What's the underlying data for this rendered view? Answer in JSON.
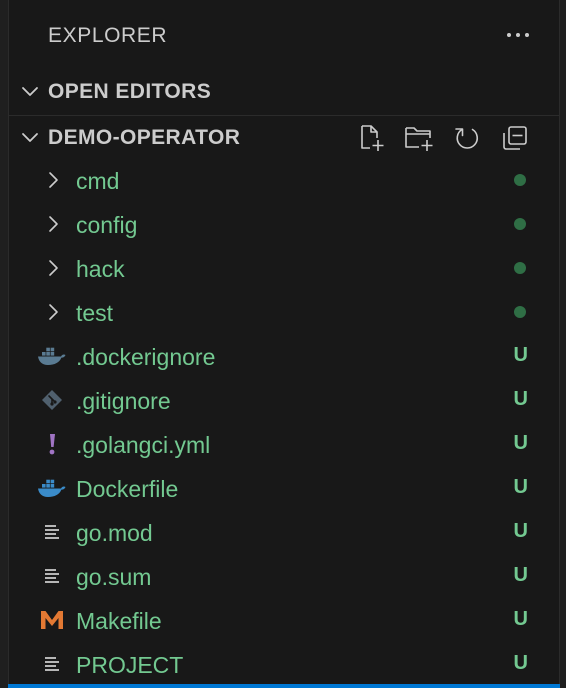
{
  "panel": {
    "title": "EXPLORER",
    "more_icon": "ellipsis-icon"
  },
  "sections": {
    "open_editors": {
      "label": "OPEN EDITORS",
      "expanded": false
    },
    "project": {
      "label": "DEMO-OPERATOR",
      "expanded": true,
      "actions": [
        {
          "name": "new-file-button",
          "icon": "new-file-icon"
        },
        {
          "name": "new-folder-button",
          "icon": "new-folder-icon"
        },
        {
          "name": "refresh-explorer-button",
          "icon": "refresh-icon"
        },
        {
          "name": "collapse-folders-button",
          "icon": "collapse-all-icon"
        }
      ]
    }
  },
  "tree": {
    "folders": [
      {
        "name": "cmd",
        "status": "modified-dot"
      },
      {
        "name": "config",
        "status": "modified-dot"
      },
      {
        "name": "hack",
        "status": "modified-dot"
      },
      {
        "name": "test",
        "status": "modified-dot"
      }
    ],
    "files": [
      {
        "name": ".dockerignore",
        "icon": "docker-icon-muted",
        "badge": "U"
      },
      {
        "name": ".gitignore",
        "icon": "git-icon",
        "badge": "U"
      },
      {
        "name": ".golangci.yml",
        "icon": "yaml-exclamation-icon",
        "badge": "U"
      },
      {
        "name": "Dockerfile",
        "icon": "docker-icon",
        "badge": "U"
      },
      {
        "name": "go.mod",
        "icon": "text-lines-icon",
        "badge": "U"
      },
      {
        "name": "go.sum",
        "icon": "text-lines-icon",
        "badge": "U"
      },
      {
        "name": "Makefile",
        "icon": "makefile-m-icon",
        "badge": "U"
      },
      {
        "name": "PROJECT",
        "icon": "text-lines-icon",
        "badge": "U"
      }
    ]
  },
  "colors": {
    "background": "#181818",
    "untracked_text": "#73c991",
    "modified_dot": "#2f6e45",
    "docker_blue": "#3a8bc9",
    "makefile_orange": "#e37933",
    "yaml_purple": "#a074c4",
    "focus_accent": "#0078d4"
  }
}
